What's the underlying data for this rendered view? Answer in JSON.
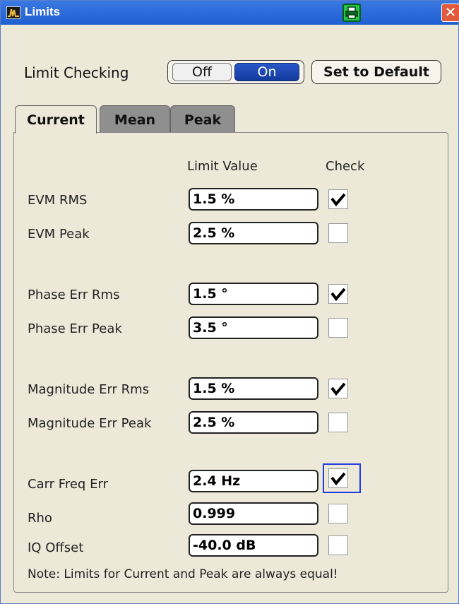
{
  "window": {
    "title": "Limits",
    "app_icon": "waveform-app-icon",
    "print_icon": "printer-icon",
    "close_icon": "close-icon"
  },
  "limit_checking": {
    "label": "Limit Checking",
    "off_label": "Off",
    "on_label": "On",
    "selected": "On",
    "default_button": "Set to Default"
  },
  "tabs": [
    {
      "label": "Current",
      "active": true
    },
    {
      "label": "Mean",
      "active": false
    },
    {
      "label": "Peak",
      "active": false
    }
  ],
  "table": {
    "header_value": "Limit Value",
    "header_check": "Check",
    "rows": [
      {
        "label": "EVM RMS",
        "value": "1.5 %",
        "checked": true
      },
      {
        "label": "EVM Peak",
        "value": "2.5 %",
        "checked": false
      },
      {
        "label": "Phase Err Rms",
        "value": "1.5 °",
        "checked": true
      },
      {
        "label": "Phase Err Peak",
        "value": "3.5 °",
        "checked": false
      },
      {
        "label": "Magnitude Err Rms",
        "value": "1.5 %",
        "checked": true
      },
      {
        "label": "Magnitude Err Peak",
        "value": "2.5 %",
        "checked": false
      },
      {
        "label": "Carr Freq Err",
        "value": "2.4 Hz",
        "checked": true,
        "focused": true
      },
      {
        "label": "Rho",
        "value": "0.999",
        "checked": false
      },
      {
        "label": "IQ Offset",
        "value": "-40.0 dB",
        "checked": false
      }
    ]
  },
  "note": "Note: Limits for Current and Peak are always equal!",
  "colors": {
    "titlebar": "#2a6ad8",
    "toggle_on": "#1f48b5",
    "focus": "#1f3de0",
    "inactive_tab": "#8f8f8f"
  }
}
